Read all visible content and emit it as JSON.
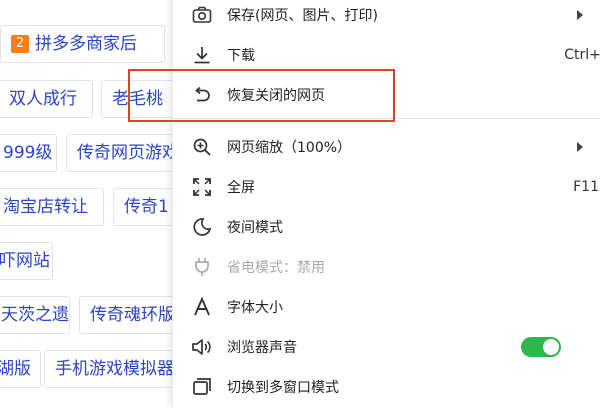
{
  "background_chips": [
    {
      "badge": "2",
      "text": "拼多多商家后"
    },
    {
      "text": "双人成行"
    },
    {
      "text": "老毛桃"
    },
    {
      "text": "999级"
    },
    {
      "text": "传奇网页游戏"
    },
    {
      "text": "淘宝店转让"
    },
    {
      "text": "传奇1"
    },
    {
      "text": "吓网站"
    },
    {
      "text": "天茨之遗"
    },
    {
      "text": "传奇魂环版"
    },
    {
      "text": "湖版"
    },
    {
      "text": "手机游戏模拟器"
    }
  ],
  "menu": {
    "items": [
      {
        "label": "保存(网页、图片、打印)",
        "icon": "camera-icon",
        "arrow": true
      },
      {
        "label": "下载",
        "icon": "download-icon",
        "shortcut": "Ctrl+J"
      },
      {
        "label": "恢复关闭的网页",
        "icon": "undo-icon"
      },
      {
        "label": "网页缩放（100%）",
        "icon": "zoom-icon",
        "arrow": true
      },
      {
        "label": "全屏",
        "icon": "fullscreen-icon",
        "shortcut": "F11"
      },
      {
        "label": "夜间模式",
        "icon": "moon-icon"
      },
      {
        "label": "省电模式：禁用",
        "icon": "plug-icon",
        "disabled": true
      },
      {
        "label": "字体大小",
        "icon": "font-size-icon"
      },
      {
        "label": "浏览器声音",
        "icon": "speaker-icon",
        "toggle_on": true
      },
      {
        "label": "切换到多窗口模式",
        "icon": "multi-window-icon"
      }
    ],
    "highlight_color": "#e0412b",
    "toggle_color": "#2db84c"
  }
}
